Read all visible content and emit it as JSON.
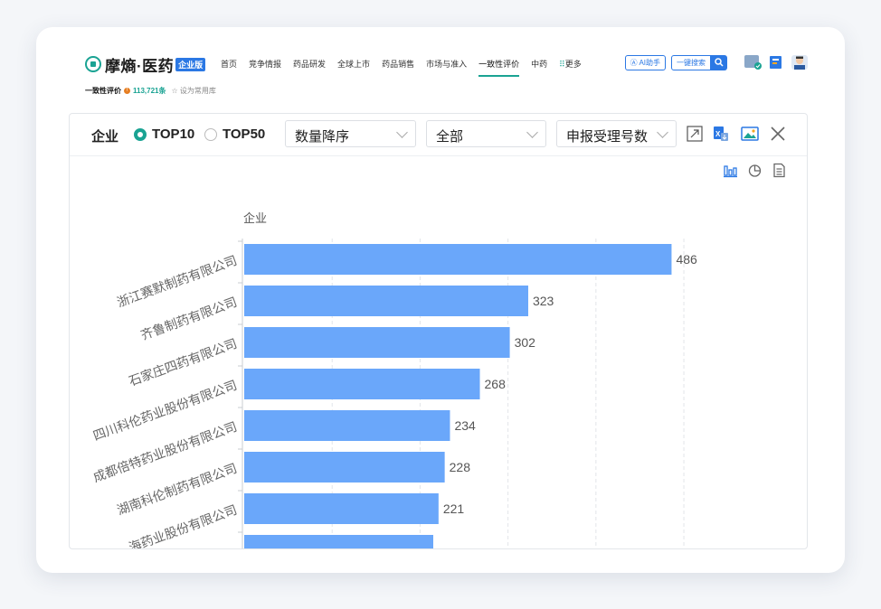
{
  "nav": {
    "logo": "摩熵·医药",
    "logo_badge": "企业版",
    "menu": [
      "首页",
      "竞争情报",
      "药品研发",
      "全球上市",
      "药品销售",
      "市场与准入",
      "一致性评价",
      "中药",
      "更多"
    ],
    "active_index": 6,
    "ai_label": "AI助手",
    "search_label": "一键搜索"
  },
  "subheader": {
    "title": "一致性评价",
    "count": "113,721条",
    "favorite": "设为常用库"
  },
  "toolbar": {
    "label": "企业",
    "radio_top10": "TOP10",
    "radio_top50": "TOP50",
    "sort": "数量降序",
    "filter": "全部",
    "metric": "申报受理号数"
  },
  "colors": {
    "accent": "#1aa393",
    "bar": "#6aa7fa",
    "brand": "#2b78e4"
  },
  "chart_data": {
    "type": "bar",
    "orientation": "horizontal",
    "ylabel": "企业",
    "categories": [
      "浙江赛默制药有限公司",
      "齐鲁制药有限公司",
      "石家庄四药有限公司",
      "四川科伦药业股份有限公司",
      "成都倍特药业股份有限公司",
      "湖南科伦制药有限公司",
      "海药业股份有限公司"
    ],
    "values": [
      486,
      323,
      302,
      268,
      234,
      228,
      221
    ],
    "xlim": [
      0,
      500
    ],
    "grid": true
  }
}
